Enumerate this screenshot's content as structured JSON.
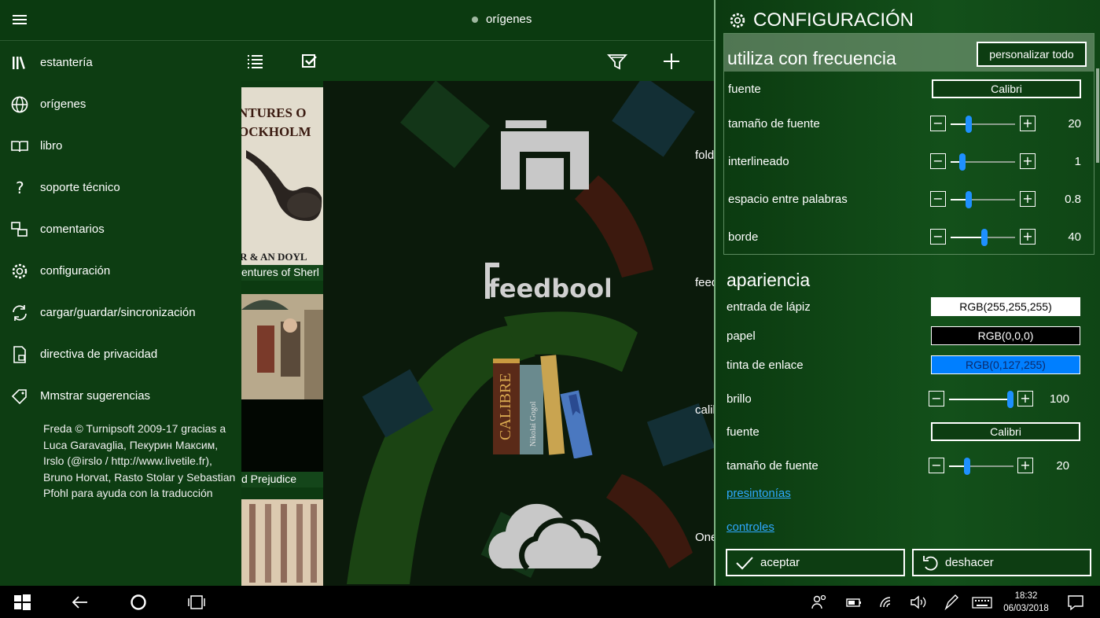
{
  "window": {
    "title": "orígenes"
  },
  "sidebar": {
    "items": [
      {
        "label": "estantería",
        "icon": "library-icon"
      },
      {
        "label": "orígenes",
        "icon": "globe-icon"
      },
      {
        "label": "libro",
        "icon": "open-book-icon"
      },
      {
        "label": "soporte técnico",
        "icon": "question-icon"
      },
      {
        "label": "comentarios",
        "icon": "feedback-icon"
      },
      {
        "label": "configuración",
        "icon": "gear-icon"
      },
      {
        "label": "cargar/guardar/sincronización",
        "icon": "sync-icon"
      },
      {
        "label": "directiva de privacidad",
        "icon": "privacy-lock-icon"
      },
      {
        "label": "Mmstrar sugerencias",
        "icon": "tag-icon"
      }
    ],
    "credits": "Freda © Turnipsoft 2009-17 gracias a Luca Garavaglia, Пекурин Максим, Irslo (@irslo / http://www.livetile.fr), Bruno Horvat, Rasto Stolar y Sebastian Pfohl para ayuda con la traducción"
  },
  "toolbar": {
    "icons": [
      "list-view-icon",
      "select-icon",
      "filter-icon",
      "add-icon"
    ]
  },
  "books": [
    {
      "cover_text_top": "NTURES O",
      "cover_text_mid": "OCKHOLM",
      "cover_text_bottom": "R & AN DOYL",
      "caption": "entures of Sherl"
    },
    {
      "caption": "d Prejudice"
    },
    {
      "caption": ""
    }
  ],
  "sources": [
    {
      "label": "folder",
      "icon": "folder-icon"
    },
    {
      "label": "feedbooks",
      "logo_text": "feedbooks",
      "icon": "feedbooks-logo"
    },
    {
      "label": "calibre",
      "logo_text": "CALIBRE",
      "spine_text": "Nikolai Gogol",
      "icon": "calibre-books-icon"
    },
    {
      "label": "OneDrive",
      "icon": "onedrive-cloud-icon"
    }
  ],
  "settings": {
    "header": "CONFIGURACIÓN",
    "frequent": {
      "title": "utiliza con frecuencia",
      "customize_all": "personalizar todo",
      "font_label": "fuente",
      "font_value": "Calibri",
      "rows": [
        {
          "label": "tamaño de fuente",
          "value": "20",
          "level": 0.28
        },
        {
          "label": "interlineado",
          "value": "1",
          "level": 0.18
        },
        {
          "label": "espacio entre palabras",
          "value": "0.8",
          "level": 0.28
        },
        {
          "label": "borde",
          "value": "40",
          "level": 0.52
        }
      ]
    },
    "appearance": {
      "title": "apariencia",
      "ink": {
        "label": "entrada de lápiz",
        "value": "RGB(255,255,255)",
        "color": "#ffffff"
      },
      "paper": {
        "label": "papel",
        "value": "RGB(0,0,0)",
        "color": "#000000"
      },
      "link_ink": {
        "label": "tinta de enlace",
        "value": "RGB(0,127,255)",
        "color": "#007fff"
      },
      "brightness": {
        "label": "brillo",
        "value": "100",
        "level": 0.95
      },
      "font_label": "fuente",
      "font_value": "Calibri",
      "font_size": {
        "label": "tamaño de fuente",
        "value": "20",
        "level": 0.28
      },
      "presets_link": "presintonías",
      "controls_link": "controles"
    },
    "accept": "aceptar",
    "undo": "deshacer"
  },
  "taskbar": {
    "time": "18:32",
    "date": "06/03/2018"
  },
  "colors": {
    "app_bg": "#0d3d12",
    "accent": "#1e90ff",
    "link": "#2ea8ff"
  }
}
